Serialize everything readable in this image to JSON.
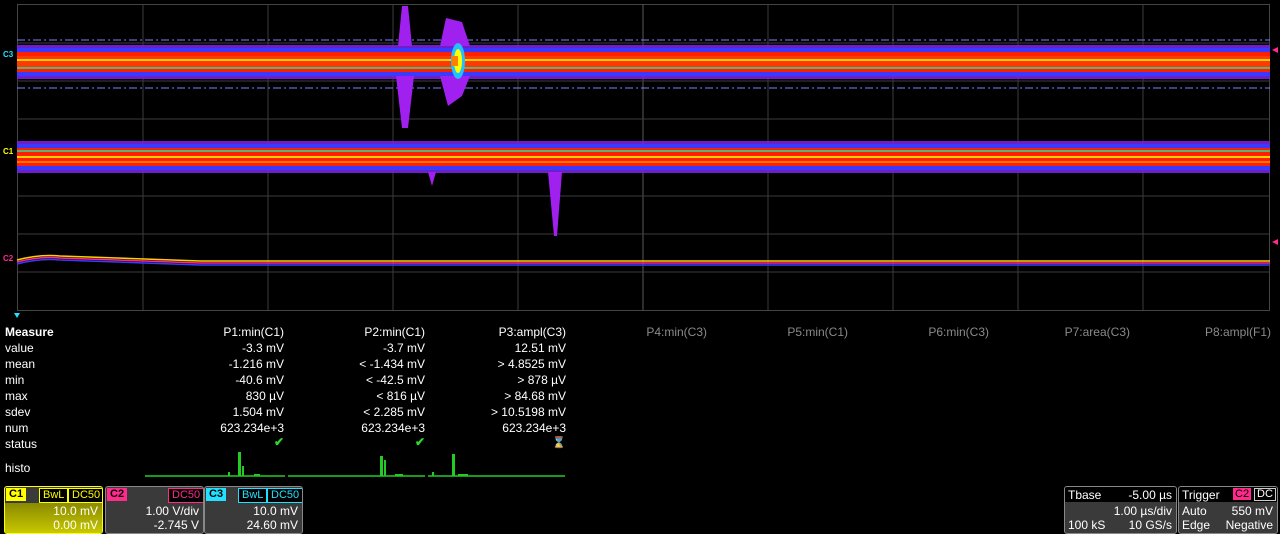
{
  "channels": {
    "c3_marker": "C3",
    "c1_marker": "C1",
    "c2_marker": "C2"
  },
  "colors": {
    "c1": "#ffff00",
    "c2": "#ff2a8c",
    "c3": "#22e0ff",
    "status_ok": "#2fd82f",
    "histo": "#22cc22",
    "trace_violet": "#a020f0",
    "trace_red": "#ff2000"
  },
  "measure": {
    "title": "Measure",
    "row_labels": [
      "value",
      "mean",
      "min",
      "max",
      "sdev",
      "num",
      "status",
      "histo"
    ],
    "params": [
      {
        "header": "P1:min(C1)",
        "active": true,
        "value": "-3.3 mV",
        "mean": "-1.216 mV",
        "min": "-40.6 mV",
        "max": "830 µV",
        "sdev": "1.504 mV",
        "num": "623.234e+3",
        "status": "✔"
      },
      {
        "header": "P2:min(C1)",
        "active": true,
        "value": "-3.7 mV",
        "mean": "< -1.434 mV",
        "min": "< -42.5 mV",
        "max": "< 816 µV",
        "sdev": "< 2.285 mV",
        "num": "623.234e+3",
        "status": "✔"
      },
      {
        "header": "P3:ampl(C3)",
        "active": true,
        "value": "12.51 mV",
        "mean": "> 4.8525 mV",
        "min": "> 878 µV",
        "max": "> 84.68 mV",
        "sdev": "> 10.5198 mV",
        "num": "623.234e+3",
        "status": "⌛"
      },
      {
        "header": "P4:min(C3)",
        "active": false
      },
      {
        "header": "P5:min(C1)",
        "active": false
      },
      {
        "header": "P6:min(C3)",
        "active": false
      },
      {
        "header": "P7:area(C3)",
        "active": false
      },
      {
        "header": "P8:ampl(F1)",
        "active": false
      }
    ]
  },
  "descriptors": {
    "c1": {
      "name": "C1",
      "tags": [
        "BwL",
        "DC50"
      ],
      "scale": "10.0 mV",
      "offset": "0.00 mV"
    },
    "c2": {
      "name": "C2",
      "tags": [
        "DC50"
      ],
      "scale": "1.00 V/div",
      "offset": "-2.745 V"
    },
    "c3": {
      "name": "C3",
      "tags": [
        "BwL",
        "DC50"
      ],
      "scale": "10.0 mV",
      "offset": "24.60 mV"
    }
  },
  "timebase": {
    "label": "Tbase",
    "delay": "-5.00 µs",
    "per_div": "1.00 µs/div",
    "samples": "100 kS",
    "rate": "10 GS/s"
  },
  "trigger": {
    "label": "Trigger",
    "source": "C2",
    "coupling": "DC",
    "mode": "Auto",
    "level": "550 mV",
    "type": "Edge",
    "slope": "Negative"
  }
}
